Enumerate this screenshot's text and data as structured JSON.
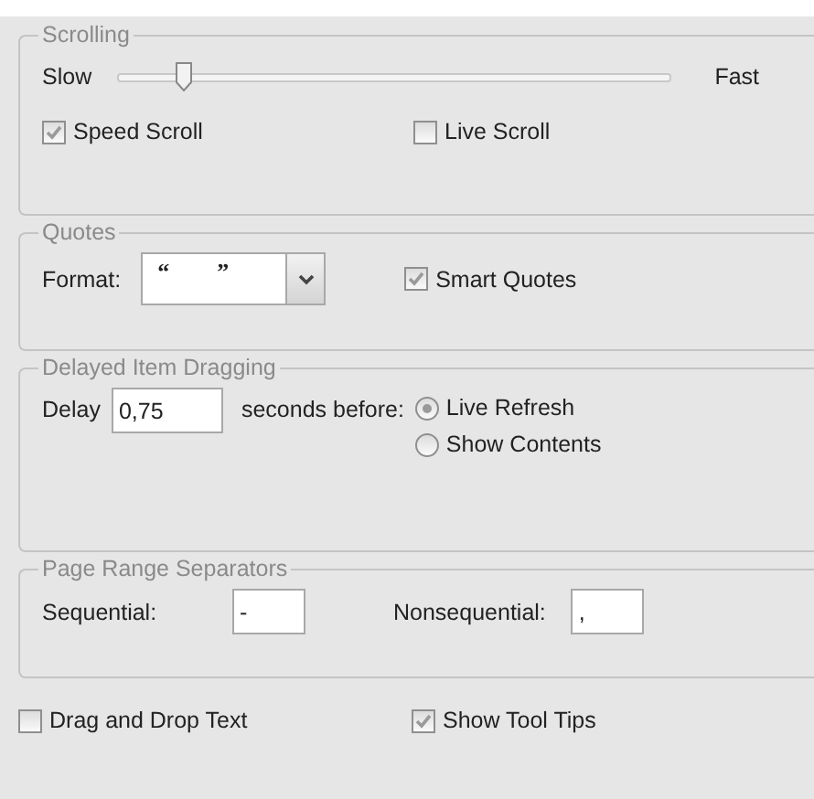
{
  "scrolling": {
    "title": "Scrolling",
    "slow_label": "Slow",
    "fast_label": "Fast",
    "speed": {
      "level": 0.12
    },
    "checkboxes": [
      {
        "label": "Speed Scroll",
        "checked": true
      },
      {
        "label": "Live Scroll",
        "checked": false
      }
    ]
  },
  "quotes": {
    "title": "Quotes",
    "format_label": "Format:",
    "open_quote": "“",
    "close_quote": "”",
    "smart_quotes": {
      "label": "Smart Quotes",
      "checked": true
    }
  },
  "delayed_dragging": {
    "title": "Delayed Item Dragging",
    "delay_label": "Delay",
    "delay_value": "0,75",
    "seconds_label": "seconds before:",
    "options": [
      {
        "label": "Live Refresh",
        "selected": true
      },
      {
        "label": "Show Contents",
        "selected": false
      }
    ]
  },
  "page_range": {
    "title": "Page Range Separators",
    "fields": [
      {
        "label": "Sequential:",
        "value": "-"
      },
      {
        "label": "Nonsequential:",
        "value": ","
      }
    ]
  },
  "options": [
    {
      "label": "Drag and Drop Text",
      "checked": false
    },
    {
      "label": "Show Tool Tips",
      "checked": true
    }
  ]
}
